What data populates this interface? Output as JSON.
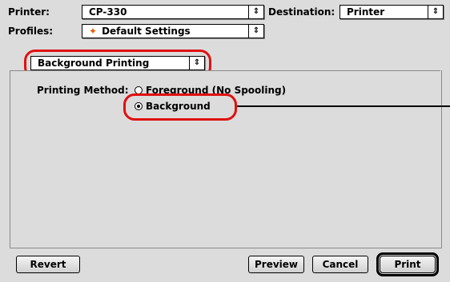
{
  "printer": {
    "label": "Printer:",
    "value": "CP-330"
  },
  "destination": {
    "label": "Destination:",
    "value": "Printer"
  },
  "profiles": {
    "label": "Profiles:",
    "value": "Default Settings"
  },
  "panel_selector": {
    "value": "Background Printing"
  },
  "printing_method": {
    "label": "Printing Method:",
    "options": [
      {
        "label": "Foreground (No Spooling)",
        "selected": false
      },
      {
        "label": "Background",
        "selected": true
      }
    ]
  },
  "buttons": {
    "revert": "Revert",
    "preview": "Preview",
    "cancel": "Cancel",
    "print": "Print"
  },
  "icons": {
    "popup_arrow": "updown-arrows-icon",
    "profile_icon": "flame-icon"
  },
  "colors": {
    "highlight": "#e01010"
  }
}
